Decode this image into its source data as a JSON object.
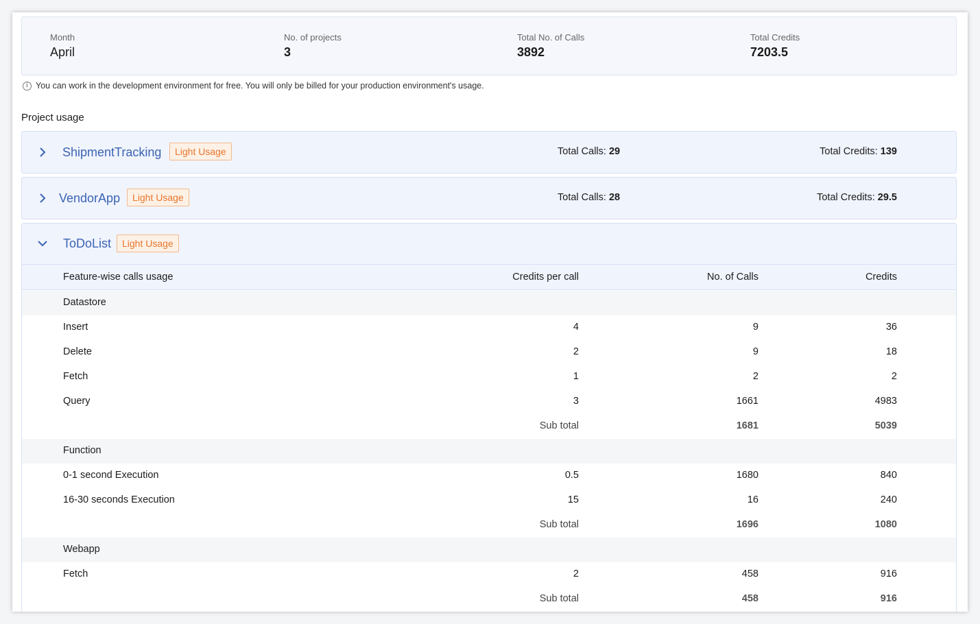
{
  "summary": {
    "month_label": "Month",
    "month_value": "April",
    "projects_label": "No. of projects",
    "projects_value": "3",
    "calls_label": "Total No. of Calls",
    "calls_value": "3892",
    "credits_label": "Total Credits",
    "credits_value": "7203.5"
  },
  "note": "You can work in the development environment for free. You will only be billed for your production environment's usage.",
  "section_title": "Project usage",
  "projects": [
    {
      "name": "ShipmentTracking",
      "badge": "Light Usage",
      "calls_label": "Total Calls: ",
      "calls_value": "29",
      "credits_label": "Total Credits: ",
      "credits_value": "139"
    },
    {
      "name": "VendorApp",
      "badge": "Light Usage",
      "calls_label": "Total Calls: ",
      "calls_value": "28",
      "credits_label": "Total Credits: ",
      "credits_value": "29.5"
    }
  ],
  "expanded": {
    "name": "ToDoList",
    "badge": "Light Usage",
    "columns": {
      "feature": "Feature-wise calls usage",
      "cpc": "Credits per call",
      "calls": "No. of Calls",
      "credits": "Credits"
    },
    "datastore": {
      "title": "Datastore",
      "rows": [
        {
          "name": "Insert",
          "cpc": "4",
          "calls": "9",
          "credits": "36"
        },
        {
          "name": "Delete",
          "cpc": "2",
          "calls": "9",
          "credits": "18"
        },
        {
          "name": "Fetch",
          "cpc": "1",
          "calls": "2",
          "credits": "2"
        },
        {
          "name": "Query",
          "cpc": "3",
          "calls": "1661",
          "credits": "4983"
        }
      ],
      "subtotal_label": "Sub total",
      "subtotal_calls": "1681",
      "subtotal_credits": "5039"
    },
    "function": {
      "title": "Function",
      "rows": [
        {
          "name": "0-1 second Execution",
          "cpc": "0.5",
          "calls": "1680",
          "credits": "840"
        },
        {
          "name": "16-30 seconds Execution",
          "cpc": "15",
          "calls": "16",
          "credits": "240"
        }
      ],
      "subtotal_label": "Sub total",
      "subtotal_calls": "1696",
      "subtotal_credits": "1080"
    },
    "webapp": {
      "title": "Webapp",
      "rows": [
        {
          "name": "Fetch",
          "cpc": "2",
          "calls": "458",
          "credits": "916"
        }
      ],
      "subtotal_label": "Sub total",
      "subtotal_calls": "458",
      "subtotal_credits": "916"
    }
  }
}
